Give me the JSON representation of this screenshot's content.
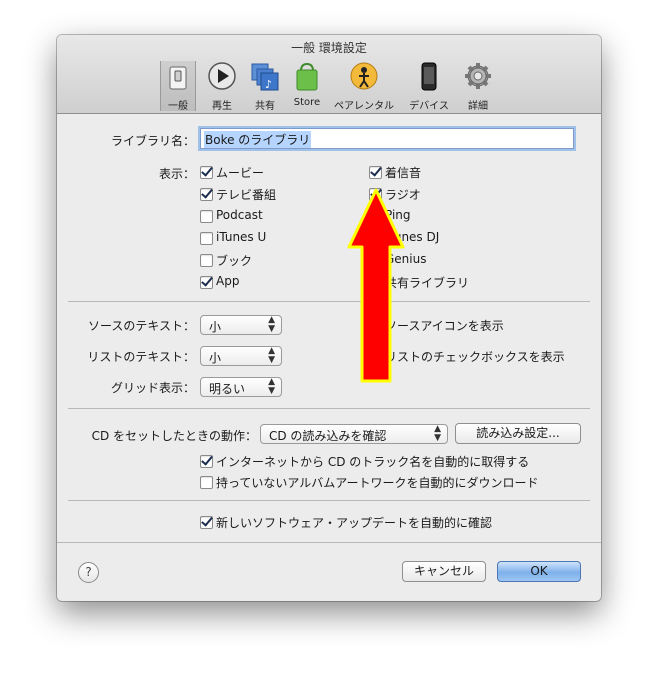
{
  "window": {
    "title": "一般 環境設定"
  },
  "toolbar": {
    "items": [
      {
        "label": "一般",
        "icon": "general-switch-icon"
      },
      {
        "label": "再生",
        "icon": "play-icon"
      },
      {
        "label": "共有",
        "icon": "sharing-icon"
      },
      {
        "label": "Store",
        "icon": "store-bag-icon"
      },
      {
        "label": "ペアレンタル",
        "icon": "parental-icon"
      },
      {
        "label": "デバイス",
        "icon": "device-icon"
      },
      {
        "label": "詳細",
        "icon": "gear-icon"
      }
    ]
  },
  "library": {
    "label": "ライブラリ名：",
    "value": "Boke のライブラリ"
  },
  "show": {
    "label": "表示：",
    "left": [
      {
        "label": "ムービー",
        "checked": true
      },
      {
        "label": "テレビ番組",
        "checked": true
      },
      {
        "label": "Podcast",
        "checked": false
      },
      {
        "label": "iTunes U",
        "checked": false
      },
      {
        "label": "ブック",
        "checked": false
      },
      {
        "label": "App",
        "checked": true
      }
    ],
    "right": [
      {
        "label": "着信音",
        "checked": true
      },
      {
        "label": "ラジオ",
        "checked": true
      },
      {
        "label": "Ping",
        "checked": false
      },
      {
        "label": "iTunes DJ",
        "checked": false
      },
      {
        "label": "Genius",
        "checked": false
      },
      {
        "label": "共有ライブラリ",
        "checked": false
      }
    ]
  },
  "text_options": {
    "source_label": "ソースのテキスト：",
    "source_value": "小",
    "list_label": "リストのテキスト：",
    "list_value": "小",
    "grid_label": "グリッド表示：",
    "grid_value": "明るい",
    "source_icons": "ソースアイコンを表示",
    "list_checkboxes": "リストのチェックボックスを表示"
  },
  "cd": {
    "label": "CD をセットしたときの動作：",
    "value": "CD の読み込みを確認",
    "import_settings": "読み込み設定...",
    "get_names": "インターネットから CD のトラック名を自動的に取得する",
    "get_names_checked": true,
    "download_artwork": "持っていないアルバムアートワークを自動的にダウンロード",
    "download_artwork_checked": false
  },
  "updates": {
    "label": "新しいソフトウェア・アップデートを自動的に確認",
    "checked": true
  },
  "footer": {
    "help": "?",
    "cancel": "キャンセル",
    "ok": "OK"
  },
  "annotation": {
    "arrow_fill": "#ff0000",
    "arrow_stroke": "#ffff00"
  }
}
